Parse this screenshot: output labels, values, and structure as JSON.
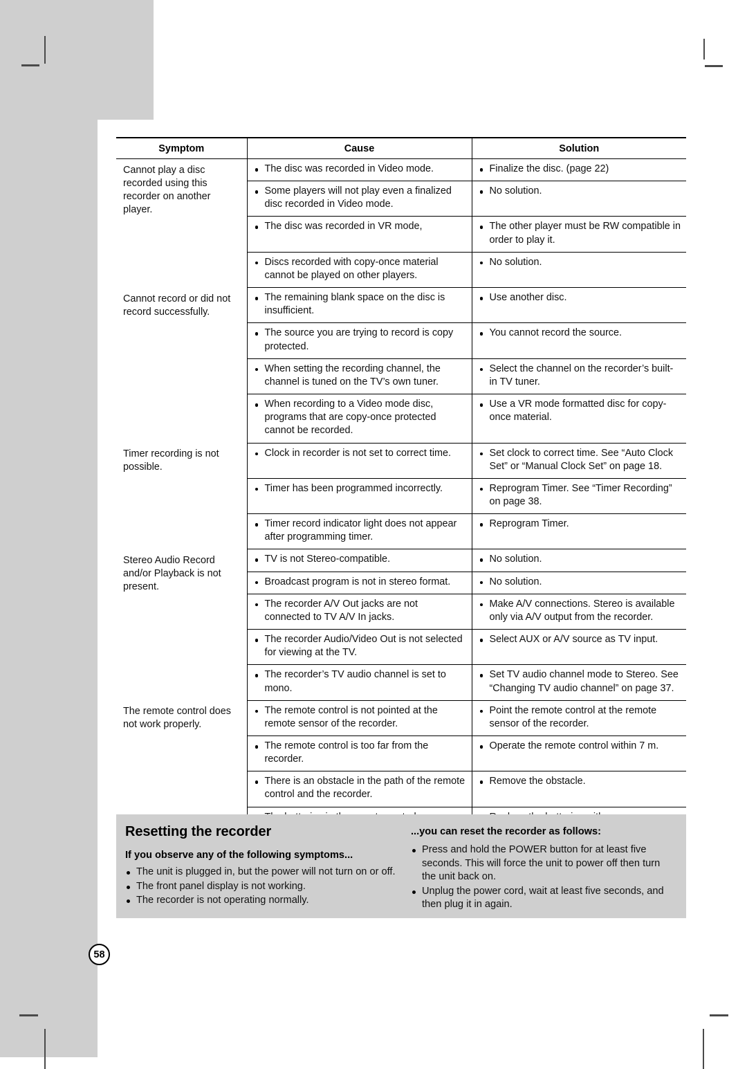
{
  "page": {
    "number": "58",
    "background_color": "#ffffff",
    "panel_gray": "#cfcfcf"
  },
  "table": {
    "headers": {
      "symptom": "Symptom",
      "cause": "Cause",
      "solution": "Solution"
    },
    "groups": [
      {
        "symptom": "Cannot play a disc recorded using this recorder on another player.",
        "rows": [
          {
            "causes": [
              "The disc was recorded in Video mode."
            ],
            "solutions": [
              "Finalize the disc. (page 22)"
            ]
          },
          {
            "causes": [
              "Some players will not play even a finalized disc recorded in Video mode."
            ],
            "solutions": [
              "No solution."
            ]
          },
          {
            "causes": [
              "The disc was recorded in VR mode,"
            ],
            "solutions": [
              "The other player must be RW compatible in order to play it."
            ]
          },
          {
            "causes": [
              "Discs recorded with copy-once material cannot be played on other players."
            ],
            "solutions": [
              "No solution."
            ]
          }
        ]
      },
      {
        "symptom": "Cannot record or did not record successfully.",
        "rows": [
          {
            "causes": [
              "The remaining blank space on the disc is insufficient."
            ],
            "solutions": [
              "Use another disc."
            ]
          },
          {
            "causes": [
              "The source you are trying to record is copy protected."
            ],
            "solutions": [
              "You cannot record the source."
            ]
          },
          {
            "causes": [
              "When setting the recording channel, the channel is tuned on the TV’s own tuner."
            ],
            "solutions": [
              "Select the channel on the recorder’s built-in TV tuner."
            ]
          },
          {
            "causes": [
              "When recording to a Video mode disc, programs that are copy-once protected cannot be recorded."
            ],
            "solutions": [
              "Use a VR mode formatted disc for copy-once material."
            ]
          }
        ]
      },
      {
        "symptom": "Timer recording is not possible.",
        "rows": [
          {
            "causes": [
              "Clock in recorder is not set to correct time."
            ],
            "solutions": [
              "Set clock to correct time. See “Auto Clock Set” or “Manual Clock Set” on page 18."
            ]
          },
          {
            "causes": [
              "Timer has been programmed incorrectly."
            ],
            "solutions": [
              "Reprogram Timer. See “Timer Recording” on page 38."
            ]
          },
          {
            "causes": [
              "Timer record indicator light does not appear after programming timer."
            ],
            "solutions": [
              "Reprogram Timer."
            ]
          }
        ]
      },
      {
        "symptom": "Stereo Audio Record and/or Playback is not present.",
        "rows": [
          {
            "causes": [
              "TV is not Stereo-compatible."
            ],
            "solutions": [
              "No solution."
            ]
          },
          {
            "causes": [
              "Broadcast program is not in stereo format."
            ],
            "solutions": [
              "No solution."
            ]
          },
          {
            "causes": [
              "The recorder A/V Out jacks are not connected to TV A/V In jacks."
            ],
            "solutions": [
              "Make A/V connections. Stereo is available only via A/V output from the recorder."
            ]
          },
          {
            "causes": [
              "The recorder Audio/Video Out is not selected for viewing at the TV."
            ],
            "solutions": [
              "Select AUX or A/V source as TV input."
            ]
          },
          {
            "causes": [
              "The recorder’s TV audio channel is set to mono."
            ],
            "solutions": [
              "Set TV audio channel mode to Stereo. See “Changing TV audio channel” on page 37."
            ]
          }
        ]
      },
      {
        "symptom": "The remote control does not work properly.",
        "rows": [
          {
            "causes": [
              "The remote control is not pointed at the remote sensor of the recorder."
            ],
            "solutions": [
              "Point the remote control at the remote sensor of the recorder."
            ]
          },
          {
            "causes": [
              "The remote control is too far from the recorder."
            ],
            "solutions": [
              "Operate the remote control within 7 m."
            ]
          },
          {
            "causes": [
              "There is an obstacle in the path of the remote control and the recorder."
            ],
            "solutions": [
              "Remove the obstacle."
            ]
          },
          {
            "causes": [
              "The batteries in the remote control are exhausted."
            ],
            "solutions": [
              "Replace the batteries with new ones."
            ]
          }
        ]
      }
    ]
  },
  "reset_panel": {
    "title": "Resetting the recorder",
    "left_subtitle": "If you observe any of the following symptoms...",
    "left_items": [
      "The unit is plugged in, but the power will not turn on or off.",
      "The front panel display is not working.",
      "The recorder is not operating normally."
    ],
    "right_subtitle": "...you can reset the recorder as follows:",
    "right_items": [
      "Press and hold the POWER button for at least five seconds. This will force the unit to power off then turn the unit back on.",
      "Unplug the power cord, wait at least five seconds, and then plug it in again."
    ]
  }
}
